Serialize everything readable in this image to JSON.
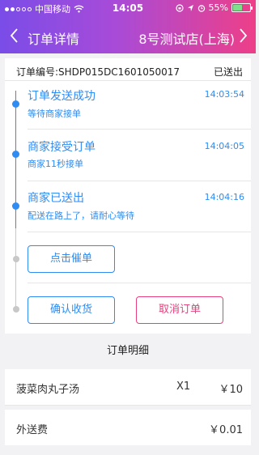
{
  "status_bar": {
    "carrier": "中国移动",
    "time": "14:05",
    "battery": "55%",
    "battery_level": 0.55,
    "icons": [
      "signal-dots-icon",
      "wifi-icon",
      "orientation-lock-icon",
      "location-icon",
      "alarm-icon",
      "battery-icon"
    ]
  },
  "nav": {
    "title": "订单详情",
    "store": "8号测试店(上海)",
    "back_icon": "chevron-left-icon",
    "forward_icon": "chevron-right-icon"
  },
  "order": {
    "number_label": "订单编号:SHDP015DC1601050017",
    "state": "已送出"
  },
  "events": [
    {
      "title": "订单发送成功",
      "subtitle": "等待商家接单",
      "time": "14:03:54"
    },
    {
      "title": "商家接受订单",
      "subtitle": "商家11秒接单",
      "time": "14:04:05"
    },
    {
      "title": "商家已送出",
      "subtitle": "配送在路上了，请耐心等待",
      "time": "14:04:16"
    }
  ],
  "actions": {
    "urge": "点击催单",
    "confirm": "确认收货",
    "cancel": "取消订单"
  },
  "details": {
    "header": "订单明细",
    "items": [
      {
        "name": "菠菜肉丸子汤",
        "qty": "X1",
        "price": "￥10"
      }
    ],
    "delivery_fee_label": "外送费",
    "delivery_fee": "￥0.01"
  },
  "colors": {
    "accent_blue": "#2f8cf2",
    "accent_pink": "#e8407e",
    "header_gradient_start": "#7a4ce8",
    "header_gradient_end": "#ee3f88"
  }
}
